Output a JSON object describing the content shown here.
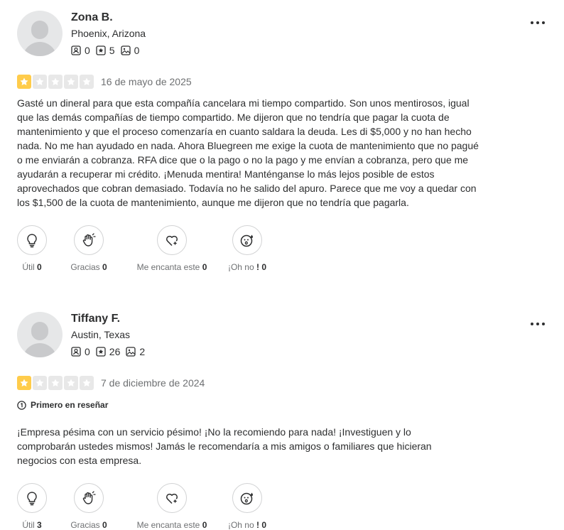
{
  "colors": {
    "star_active": "#ffcc4b",
    "star_inactive": "#e8e8e8",
    "text": "#2d2e2f",
    "muted": "#6e7072"
  },
  "reviews": [
    {
      "name": "Zona B.",
      "location": "Phoenix, Arizona",
      "stats": {
        "friends": "0",
        "reviews": "5",
        "photos": "0"
      },
      "rating": 1,
      "date": "16 de mayo de 2025",
      "badge": "",
      "text": "Gasté un dineral para que esta compañía cancelara mi tiempo compartido. Son unos mentirosos, igual que las demás compañías de tiempo compartido. Me dijeron que no tendría que pagar la cuota de mantenimiento y que el proceso comenzaría en cuanto saldara la deuda. Les di $5,000 y no han hecho nada. No me han ayudado en nada. Ahora Bluegreen me exige la cuota de mantenimiento que no pagué o me enviarán a cobranza. RFA dice que o la pago o no la pago y me envían a cobranza, pero que me ayudarán a recuperar mi crédito. ¡Menuda mentira! Manténganse lo más lejos posible de estos aprovechados que cobran demasiado. Todavía no he salido del apuro. Parece que me voy a quedar con los $1,500 de la cuota de mantenimiento, aunque me dijeron que no tendría que pagarla.",
      "reactions": {
        "util_label": "Útil",
        "util_count": "0",
        "gracias_label": "Gracias",
        "gracias_count": "0",
        "encanta_label": "Me encanta este",
        "encanta_count": "0",
        "oh_label": "¡Oh no",
        "oh_count": "! 0"
      }
    },
    {
      "name": "Tiffany F.",
      "location": "Austin, Texas",
      "stats": {
        "friends": "0",
        "reviews": "26",
        "photos": "2"
      },
      "rating": 1,
      "date": "7 de diciembre de 2024",
      "badge": "Primero en reseñar",
      "text": "¡Empresa pésima con un servicio pésimo! ¡No la recomiendo para nada! ¡Investiguen y lo comprobarán ustedes mismos! Jamás le recomendaría a mis amigos o familiares que hicieran negocios con esta empresa.",
      "reactions": {
        "util_label": "Útil",
        "util_count": "3",
        "gracias_label": "Gracias",
        "gracias_count": "0",
        "encanta_label": "Me encanta este",
        "encanta_count": "0",
        "oh_label": "¡Oh no",
        "oh_count": "! 0"
      }
    }
  ]
}
